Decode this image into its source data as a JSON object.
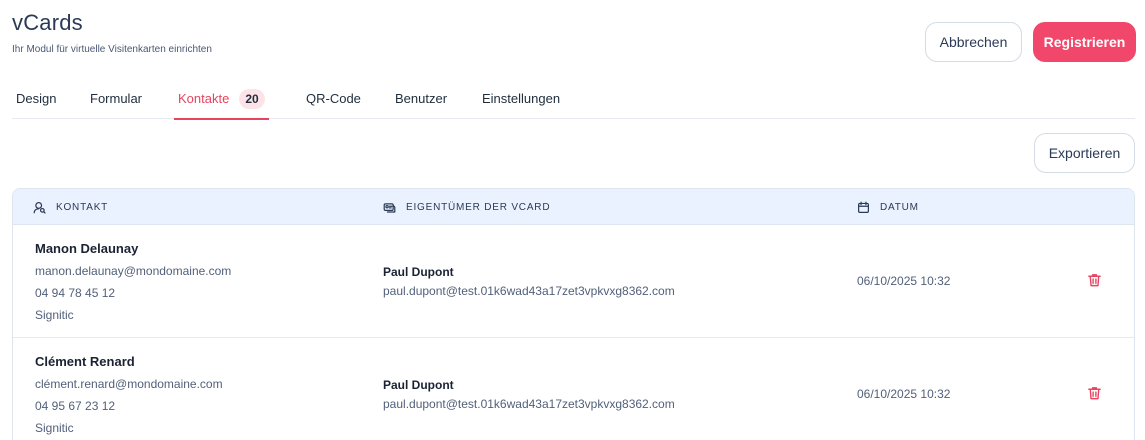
{
  "app": {
    "title": "vCards",
    "subtitle": "Ihr Modul für virtuelle Visitenkarten einrichten"
  },
  "actions": {
    "cancel_label": "Abbrechen",
    "register_label": "Registrieren",
    "export_label": "Exportieren"
  },
  "tabs": [
    {
      "label": "Design"
    },
    {
      "label": "Formular"
    },
    {
      "label": "Kontakte",
      "badge": "20",
      "active": true
    },
    {
      "label": "QR-Code"
    },
    {
      "label": "Benutzer"
    },
    {
      "label": "Einstellungen"
    }
  ],
  "table": {
    "headers": {
      "contact": "KONTAKT",
      "owner": "EIGENTÜMER DER VCARD",
      "date": "DATUM"
    },
    "rows": [
      {
        "name": "Manon Delaunay",
        "email": "manon.delaunay@mondomaine.com",
        "phone": "04 94 78 45 12",
        "company": "Signitic",
        "owner_name": "Paul Dupont",
        "owner_email": "paul.dupont@test.01k6wad43a17zet3vpkvxg8362.com",
        "date": "06/10/2025 10:32"
      },
      {
        "name": "Clément Renard",
        "email": "clément.renard@mondomaine.com",
        "phone": "04 95 67 23 12",
        "company": "Signitic",
        "owner_name": "Paul Dupont",
        "owner_email": "paul.dupont@test.01k6wad43a17zet3vpkvxg8362.com",
        "date": "06/10/2025 10:32"
      }
    ]
  },
  "colors": {
    "accent": "#f0476b",
    "active_tab": "#e8435f",
    "header_bg": "#eaf2ff",
    "delete": "#e8435f"
  },
  "icons": {
    "contact_header": "user-search-icon",
    "owner_header": "id-card-icon",
    "date_header": "calendar-icon",
    "row_action": "trash-icon"
  }
}
